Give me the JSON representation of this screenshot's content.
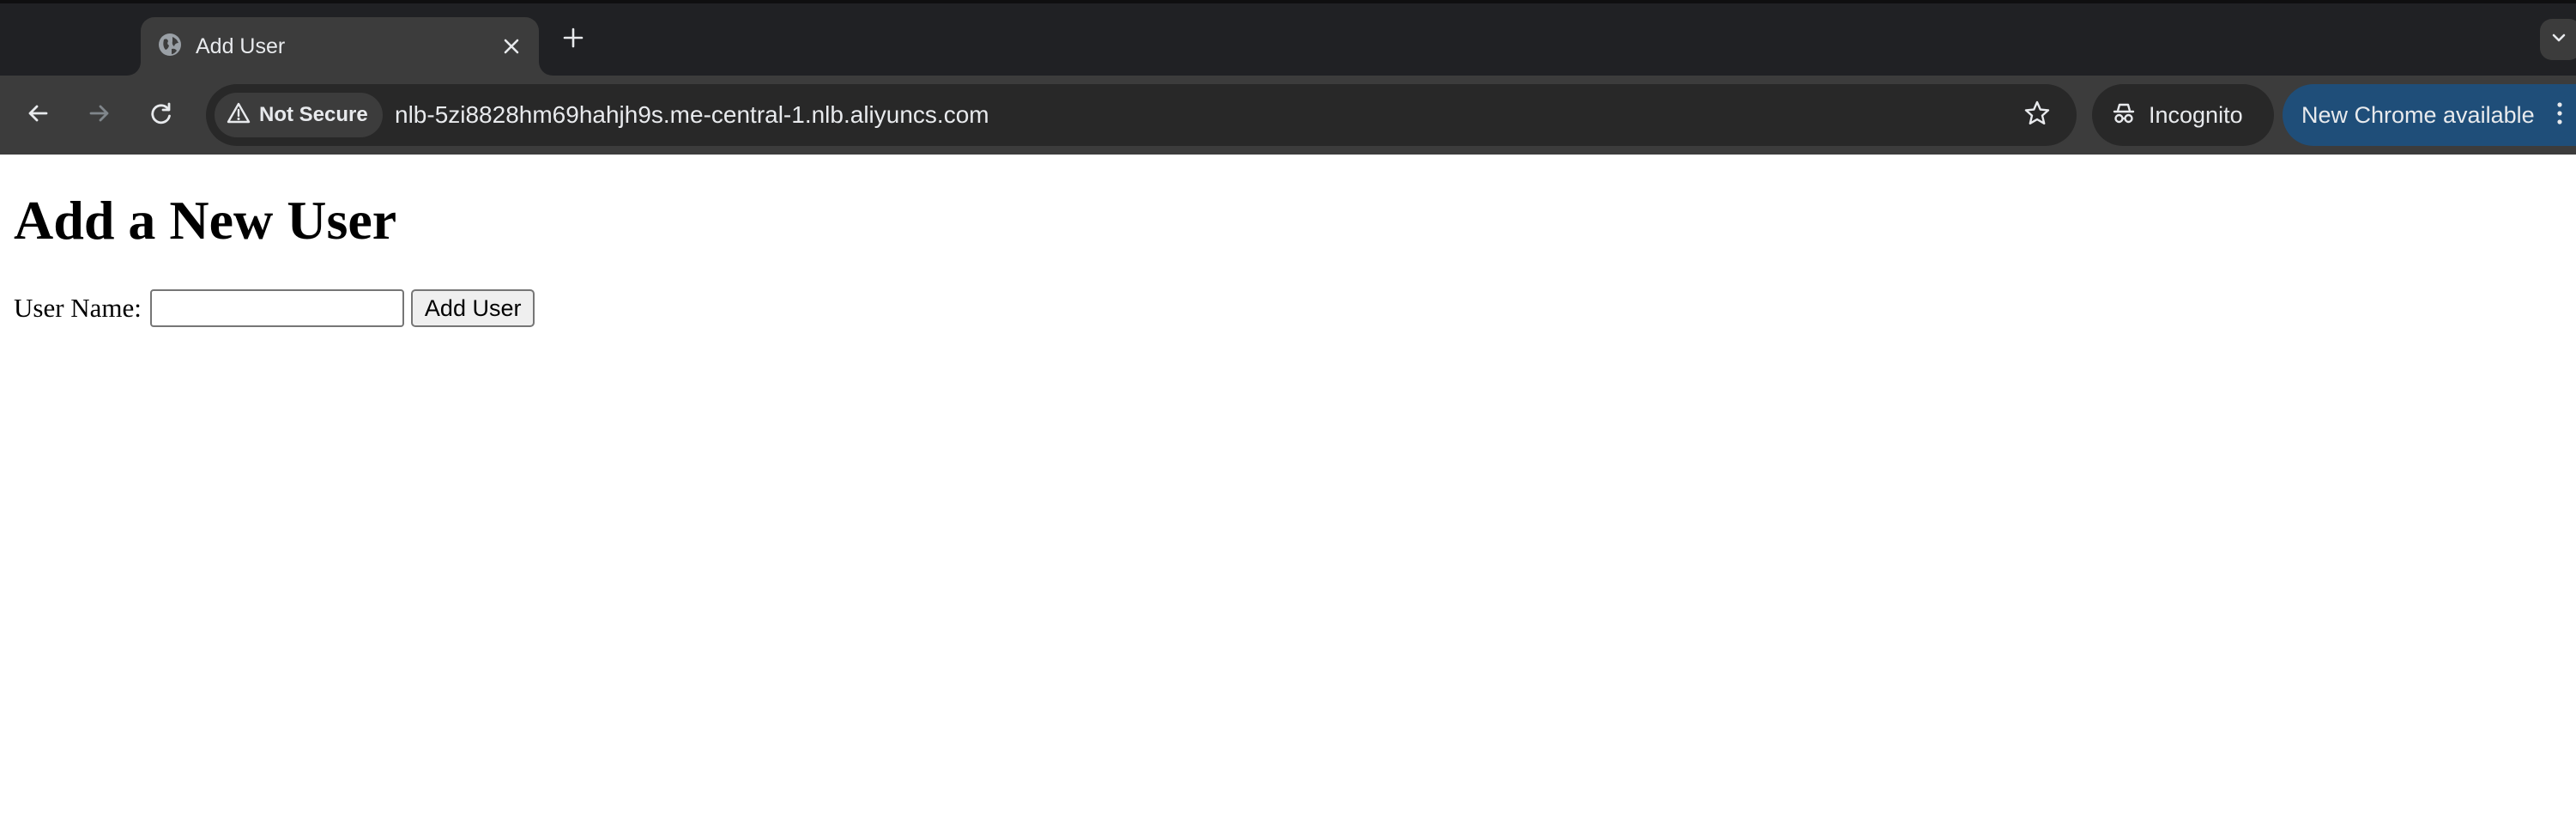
{
  "browser": {
    "tab": {
      "title": "Add User",
      "favicon": "globe-icon",
      "close_icon": "close-icon"
    },
    "new_tab_icon": "plus-icon",
    "tab_search_icon": "chevron-down-icon",
    "toolbar": {
      "back_icon": "arrow-left-icon",
      "forward_icon": "arrow-right-icon",
      "reload_icon": "reload-icon"
    },
    "omnibox": {
      "security_label": "Not Secure",
      "security_icon": "warning-triangle-icon",
      "url": "nlb-5zi8828hm69hahjh9s.me-central-1.nlb.aliyuncs.com",
      "bookmark_icon": "star-icon"
    },
    "incognito_label": "Incognito",
    "incognito_icon": "incognito-icon",
    "update_label": "New Chrome available",
    "menu_icon": "kebab-menu-icon",
    "colors": {
      "frame": "#202124",
      "toolbar": "#3c3c3c",
      "omnibox": "#282828",
      "update_chip": "#1f4e79",
      "text": "#e8eaed"
    }
  },
  "page": {
    "heading": "Add a New User",
    "form": {
      "label": "User Name:",
      "input_value": "",
      "submit_label": "Add User"
    }
  }
}
